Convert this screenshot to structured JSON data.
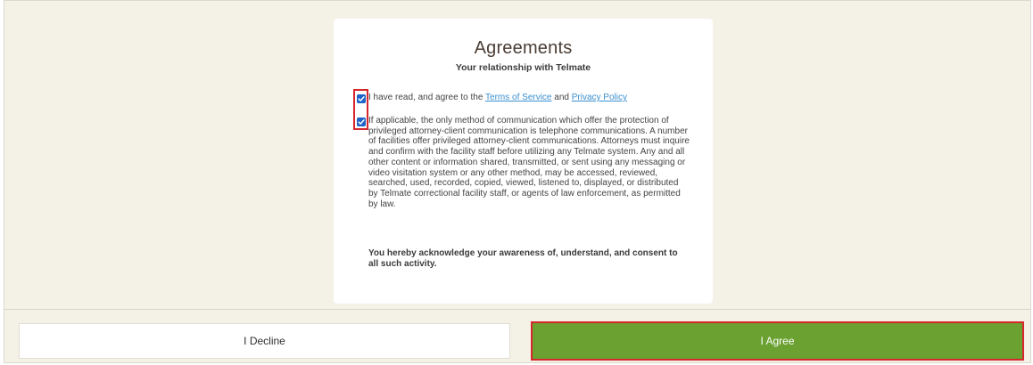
{
  "agreements": {
    "title": "Agreements",
    "subtitle": "Your relationship with Telmate",
    "terms_prefix": "I have read, and agree to the ",
    "terms_link": "Terms of Service",
    "terms_and": " and ",
    "privacy_link": "Privacy Policy",
    "terms_checked": true,
    "attorney_checked": true,
    "attorney_text": "If applicable, the only method of communication which offer the protection of privileged attorney-client communication is telephone communications. A number of facilities offer privileged attorney-client communications. Attorneys must inquire and confirm with the facility staff before utilizing any Telmate system. Any and all other content or information shared, transmitted, or sent using any messaging or video visitation system or any other method, may be accessed, reviewed, searched, used, recorded, copied, viewed, listened to, displayed, or distributed by Telmate correctional facility staff, or agents of law enforcement, as permitted by law.",
    "acknowledge_text": "You hereby acknowledge your awareness of, understand, and consent to all such activity."
  },
  "buttons": {
    "decline_label": "I Decline",
    "agree_label": "I Agree"
  },
  "colors": {
    "agree_green": "#6aa131",
    "highlight_red": "#d7262c",
    "checkbox_blue": "#1f63c6",
    "link_blue": "#3a8fd0",
    "background": "#f4f1e6"
  }
}
